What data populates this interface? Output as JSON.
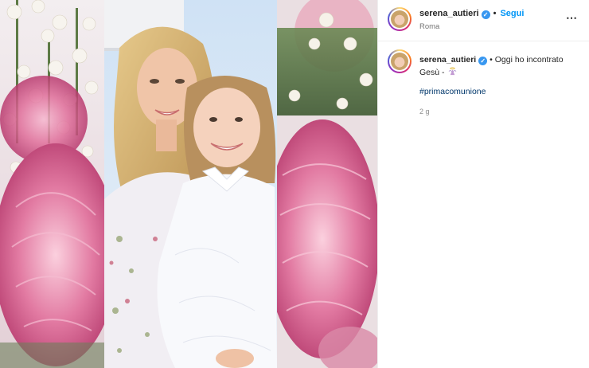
{
  "post": {
    "username": "serena_autieri",
    "verified": true,
    "follow_label": "Segui",
    "separator": "•",
    "location": "Roma",
    "more_icon": "⋯",
    "caption": {
      "username": "serena_autieri",
      "text_before": "• Oggi ho incontrato Gesù -",
      "emoji": "praying-angel-emoji",
      "hashtag": "#primacomunione",
      "time_ago": "2 g"
    }
  },
  "colors": {
    "accent": "#0095f6",
    "hashtag": "#00376b",
    "verified": "#3897f0",
    "muted": "#737373"
  }
}
